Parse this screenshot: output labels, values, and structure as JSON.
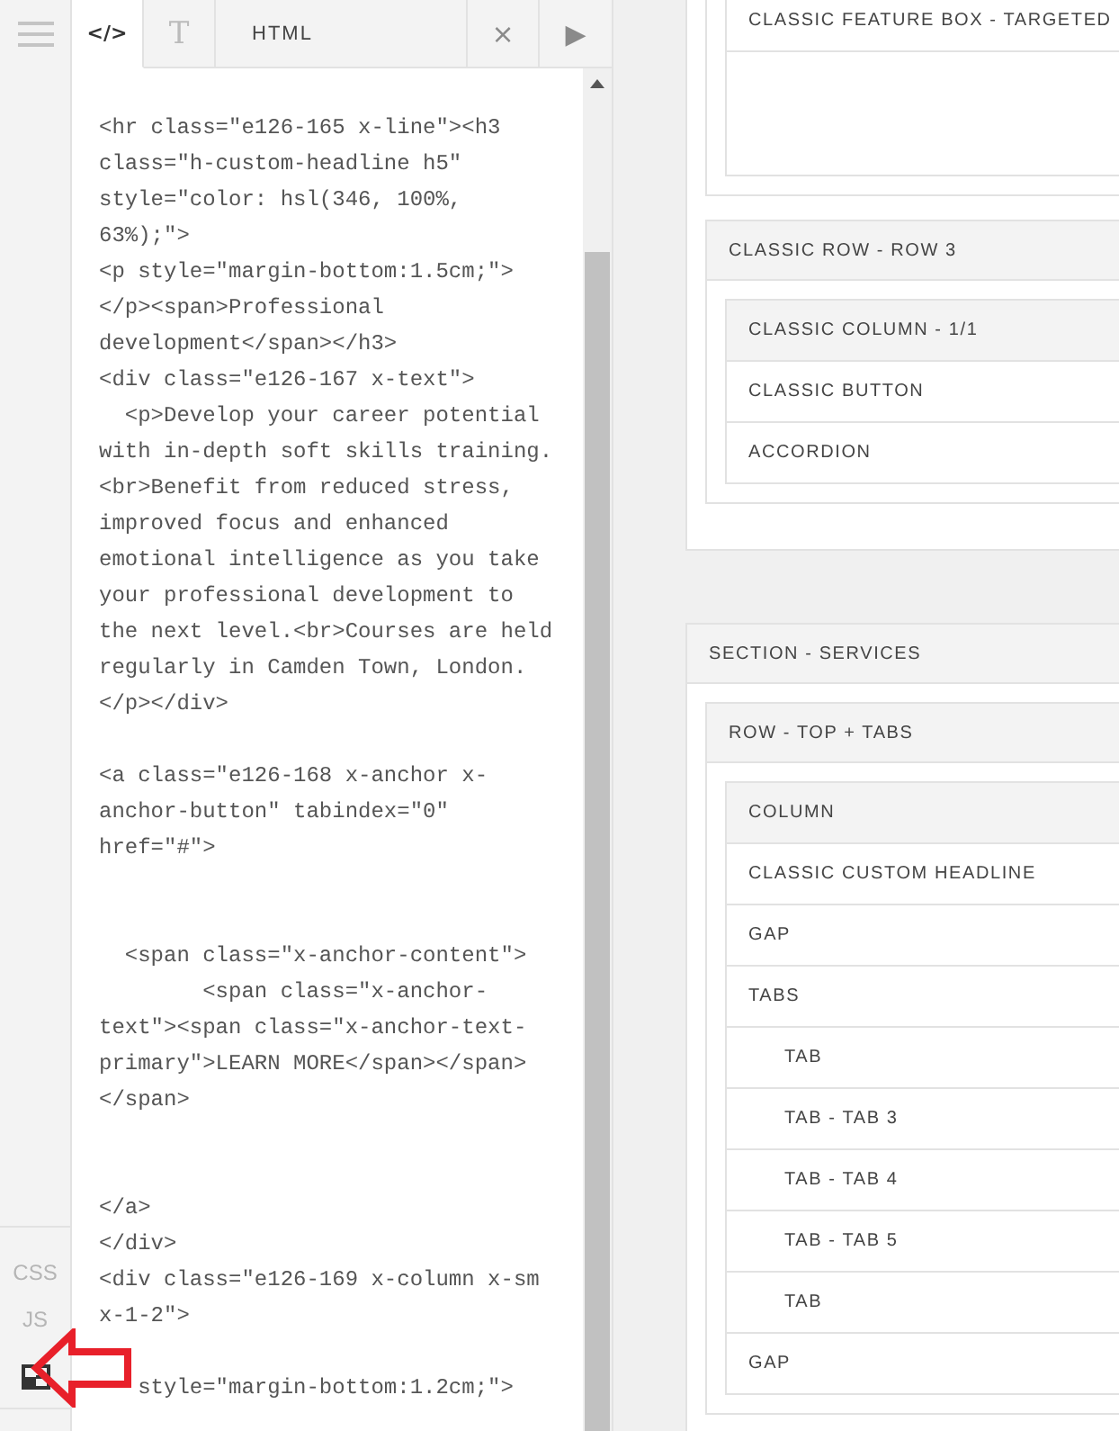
{
  "rail": {
    "items": [
      {
        "kind": "menu"
      },
      {
        "kind": "label",
        "text": "CSS"
      },
      {
        "kind": "label",
        "text": "JS"
      },
      {
        "kind": "layout"
      }
    ]
  },
  "editor": {
    "tabs": [
      {
        "text": "</>",
        "selected": true
      },
      {
        "text": "T",
        "selected": false
      }
    ],
    "title": "HTML",
    "close": "×",
    "run": "▶",
    "code": "<hr class=\"e126-165 x-line\"><h3\nclass=\"h-custom-headline h5\"\nstyle=\"color: hsl(346, 100%,\n63%);\">\n<p style=\"margin-bottom:1.5cm;\">\n</p><span>Professional\ndevelopment</span></h3>\n<div class=\"e126-167 x-text\">\n  <p>Develop your career potential\nwith in-depth soft skills training.\n<br>Benefit from reduced stress,\nimproved focus and enhanced\nemotional intelligence as you take\nyour professional development to\nthe next level.<br>Courses are held\nregularly in Camden Town, London.\n</p></div>\n\n<a class=\"e126-168 x-anchor x-\nanchor-button\" tabindex=\"0\"\nhref=\"#\">\n\n\n  <span class=\"x-anchor-content\">\n        <span class=\"x-anchor-\ntext\"><span class=\"x-anchor-text-\nprimary\">LEARN MORE</span></span>\n</span>\n\n\n</a>\n</div>\n<div class=\"e126-169 x-column x-sm\nx-1-2\">\n\n   style=\"margin-bottom:1.2cm;\">"
  },
  "structure": [
    {
      "children": [
        {
          "children": [
            {
              "children": [
                {
                  "label": "CLASSIC FEATURE BOX - TARGETED"
                },
                {
                  "kind": "spacer"
                }
              ]
            }
          ]
        },
        {
          "label": "CLASSIC ROW - ROW 3",
          "children": [
            {
              "label": "CLASSIC COLUMN - 1/1",
              "children": [
                {
                  "label": "CLASSIC BUTTON"
                },
                {
                  "label": "ACCORDION"
                }
              ]
            }
          ]
        }
      ]
    },
    {
      "label": "SECTION - SERVICES",
      "children": [
        {
          "label": "ROW - TOP + TABS",
          "children": [
            {
              "label": "COLUMN",
              "children": [
                {
                  "label": "CLASSIC CUSTOM HEADLINE"
                },
                {
                  "label": "GAP"
                },
                {
                  "label": "TABS",
                  "children": [
                    {
                      "label": "TAB"
                    },
                    {
                      "label": "TAB - TAB 3"
                    },
                    {
                      "label": "TAB - TAB 4"
                    },
                    {
                      "label": "TAB - TAB 5"
                    },
                    {
                      "label": "TAB"
                    }
                  ]
                },
                {
                  "label": "GAP"
                }
              ]
            }
          ]
        }
      ]
    }
  ]
}
